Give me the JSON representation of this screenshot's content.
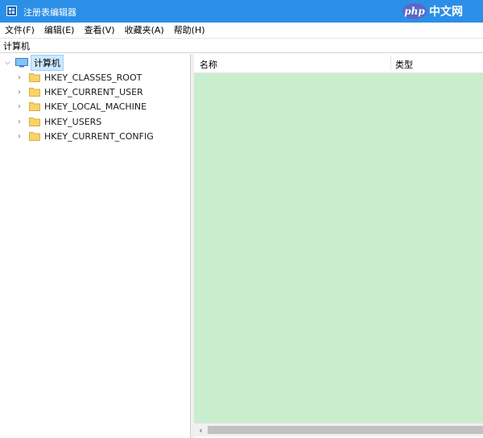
{
  "window": {
    "title": "注册表编辑器",
    "watermark": {
      "badge": "php",
      "text": "中文网"
    }
  },
  "menu": {
    "items": [
      {
        "label": "文件(F)"
      },
      {
        "label": "编辑(E)"
      },
      {
        "label": "查看(V)"
      },
      {
        "label": "收藏夹(A)"
      },
      {
        "label": "帮助(H)"
      }
    ]
  },
  "address": {
    "path": "计算机"
  },
  "tree": {
    "root": {
      "label": "计算机",
      "expanded": true,
      "icon": "computer-icon"
    },
    "children": [
      {
        "label": "HKEY_CLASSES_ROOT",
        "icon": "folder-icon"
      },
      {
        "label": "HKEY_CURRENT_USER",
        "icon": "folder-icon"
      },
      {
        "label": "HKEY_LOCAL_MACHINE",
        "icon": "folder-icon"
      },
      {
        "label": "HKEY_USERS",
        "icon": "folder-icon"
      },
      {
        "label": "HKEY_CURRENT_CONFIG",
        "icon": "folder-icon"
      }
    ]
  },
  "list": {
    "columns": [
      {
        "label": "名称"
      },
      {
        "label": "类型"
      }
    ]
  },
  "colors": {
    "titlebar": "#2b8fe8",
    "list_background": "#c9edcd",
    "selection": "#cce8ff",
    "folder": "#f7d46a"
  }
}
